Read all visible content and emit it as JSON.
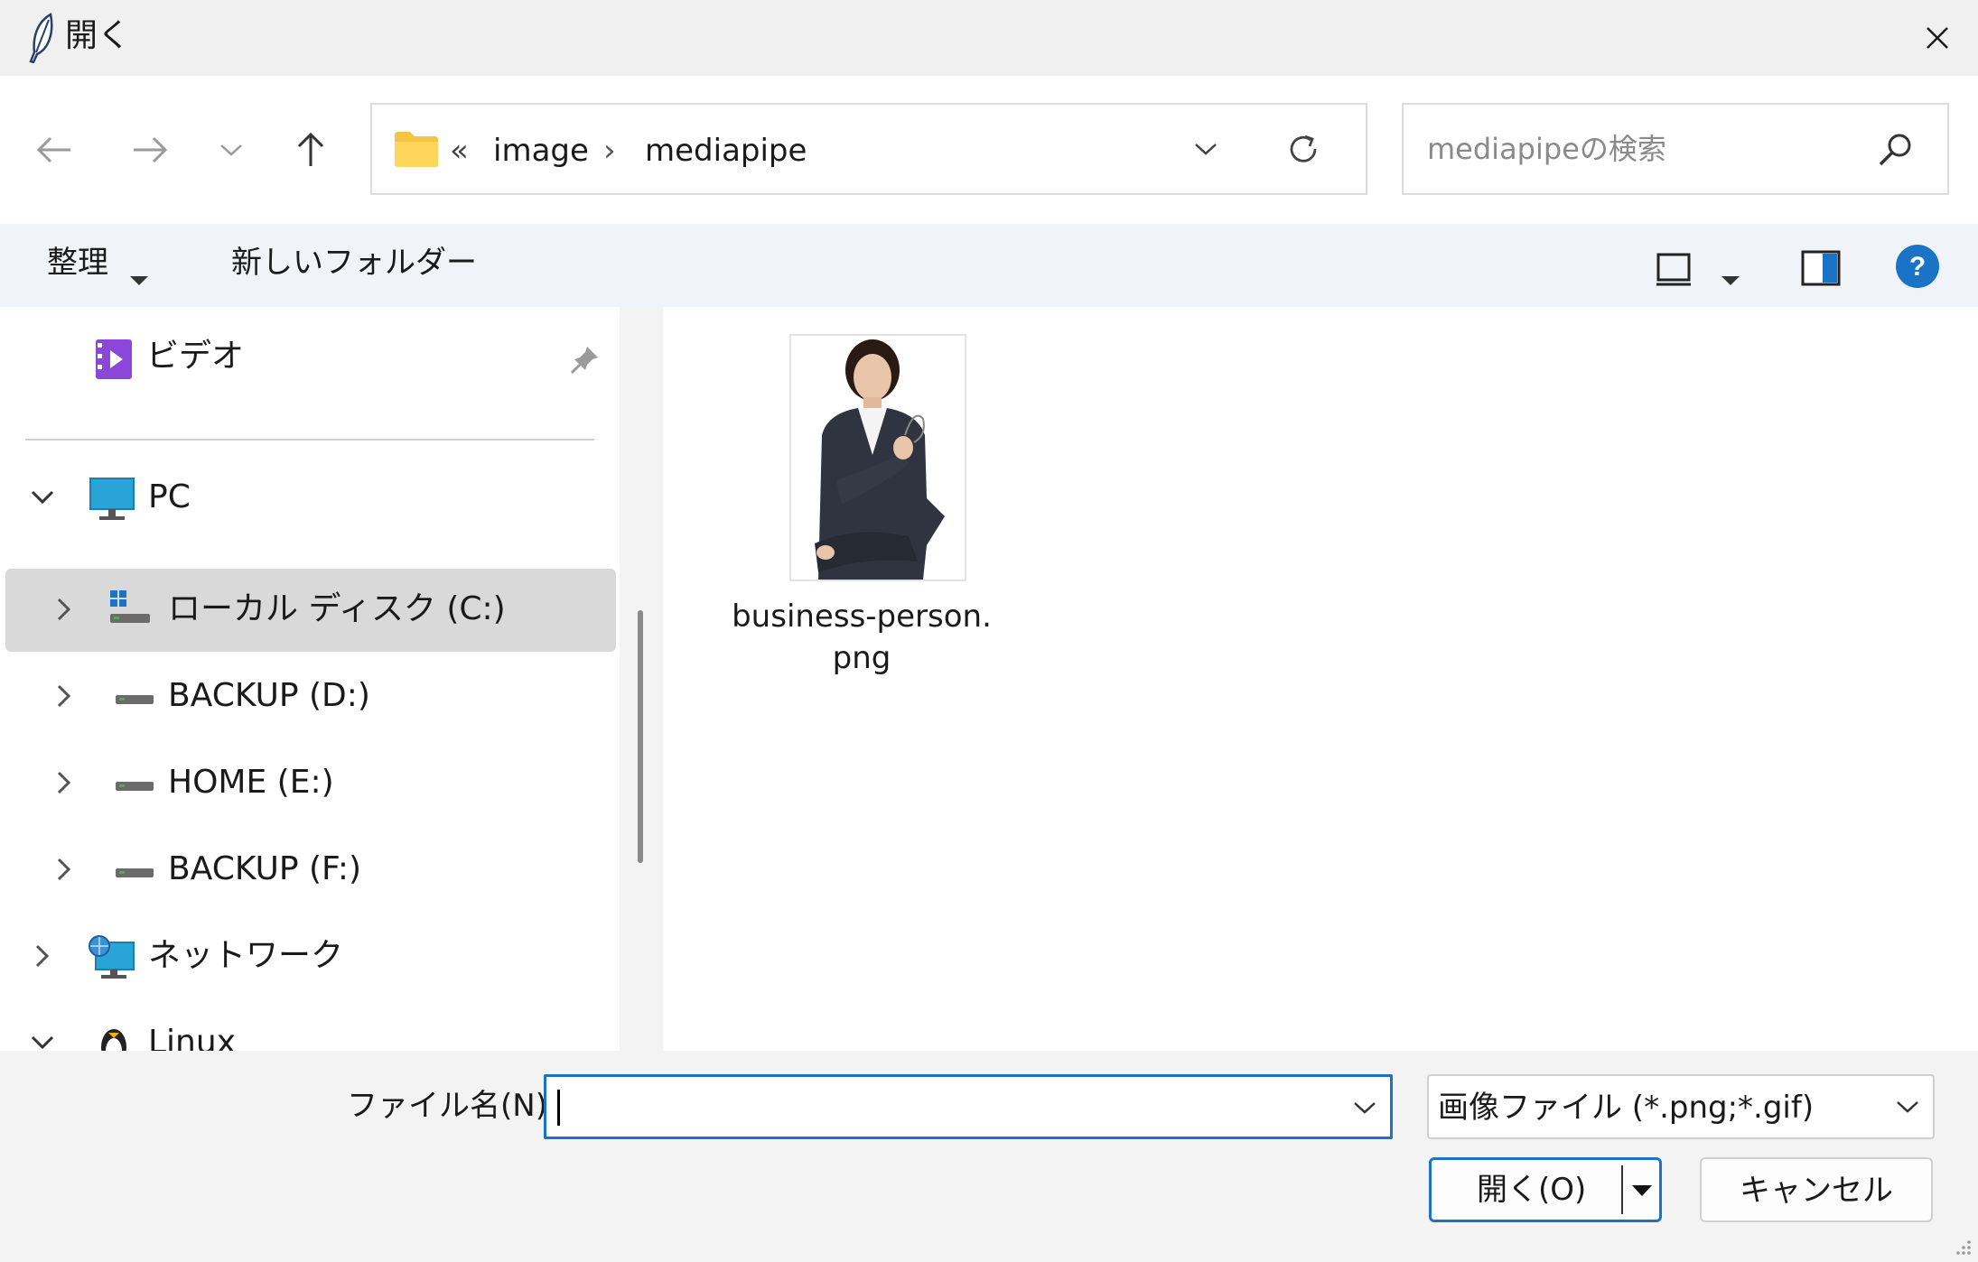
{
  "window": {
    "title": "開く",
    "close_icon": "close-icon"
  },
  "nav": {
    "back_icon": "arrow-left-icon",
    "forward_icon": "arrow-right-icon",
    "recent_icon": "chevron-down-icon",
    "up_icon": "arrow-up-icon"
  },
  "address": {
    "overflow": "«",
    "segments": [
      "image",
      "mediapipe"
    ],
    "separator": "›",
    "refresh_icon": "refresh-icon"
  },
  "search": {
    "placeholder": "mediapipeの検索"
  },
  "command_bar": {
    "organize": "整理",
    "new_folder": "新しいフォルダー"
  },
  "nav_pane": {
    "videos": "ビデオ",
    "pc": "PC",
    "drives": [
      {
        "label": "ローカル ディスク (C:)",
        "selected": true
      },
      {
        "label": "BACKUP (D:)",
        "selected": false
      },
      {
        "label": "HOME (E:)",
        "selected": false
      },
      {
        "label": "BACKUP (F:)",
        "selected": false
      }
    ],
    "network": "ネットワーク",
    "linux": "Linux"
  },
  "files": [
    {
      "name": "business-person.png"
    }
  ],
  "bottom": {
    "filename_label": "ファイル名(N):",
    "filename_value": "",
    "filetype": "画像ファイル (*.png;*.gif)",
    "open_button": "開く(O)",
    "cancel_button": "キャンセル"
  },
  "colors": {
    "accent": "#1a73c7",
    "selection": "#d9d9d9",
    "folder": "#f5c542",
    "help": "#1a73c7"
  }
}
